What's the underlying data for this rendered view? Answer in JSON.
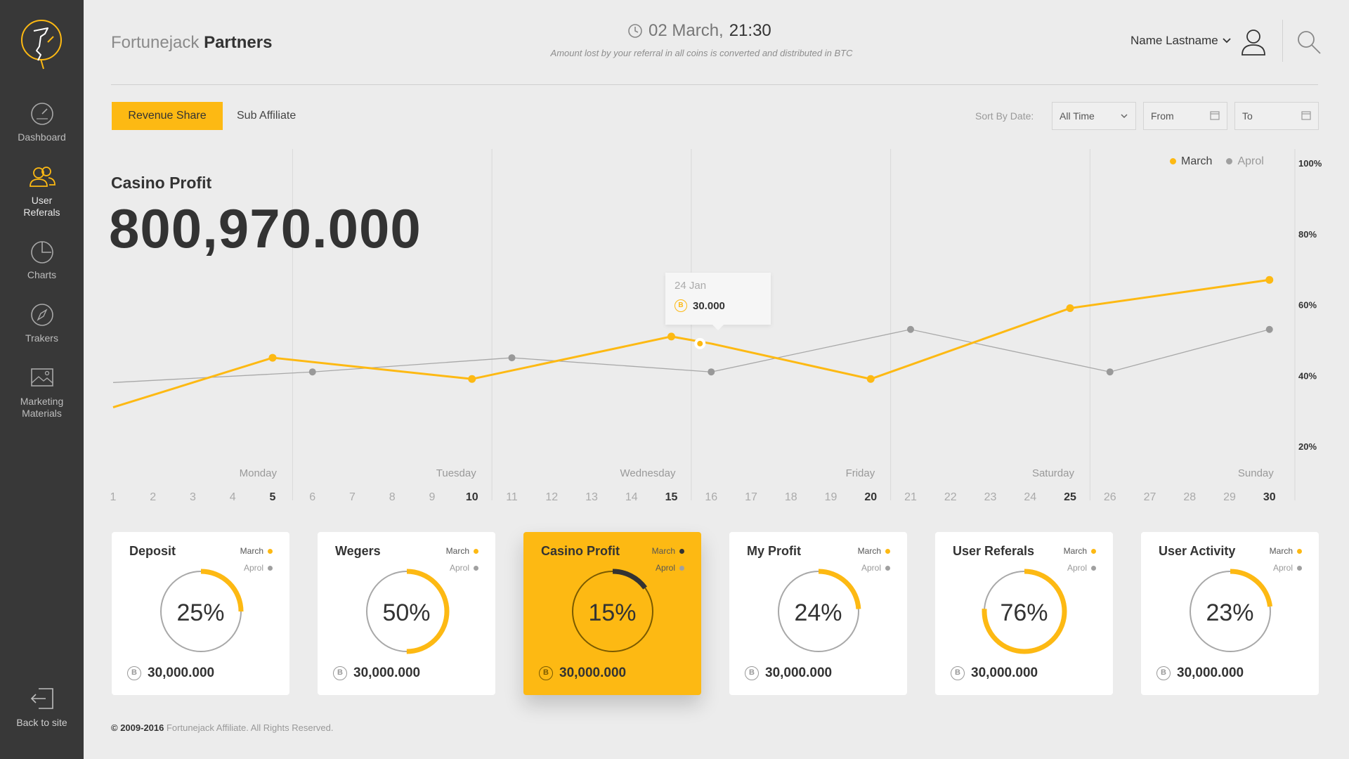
{
  "sidebar": {
    "items": [
      {
        "label": "Dashboard",
        "icon": "gauge-icon"
      },
      {
        "label": "User Referals",
        "icon": "users-icon"
      },
      {
        "label": "Charts",
        "icon": "pie-chart-icon"
      },
      {
        "label": "Trakers",
        "icon": "compass-icon"
      },
      {
        "label": "Marketing Materials",
        "icon": "image-icon"
      }
    ],
    "back_label": "Back to site"
  },
  "header": {
    "brand_light": "Fortunejack",
    "brand_bold": "Partners",
    "date": "02 March,",
    "time": "21:30",
    "note": "Amount lost by your referral in all coins is converted and distributed in BTC",
    "user_name": "Name Lastname"
  },
  "tabs": {
    "active": "Revenue Share",
    "other": "Sub Affiliate"
  },
  "filters": {
    "sort_label": "Sort By Date:",
    "period": "All Time",
    "from": "From",
    "to": "To"
  },
  "chart": {
    "title": "Casino Profit",
    "big_value": "800,970.000",
    "legend": [
      {
        "name": "March",
        "color": "#fdb913"
      },
      {
        "name": "Aprol",
        "color": "#a0a0a0"
      }
    ],
    "tooltip": {
      "date": "24 Jan",
      "value": "30.000"
    }
  },
  "chart_data": {
    "type": "line",
    "x": [
      1,
      2,
      3,
      4,
      5,
      6,
      7,
      8,
      9,
      10,
      11,
      12,
      13,
      14,
      15,
      16,
      17,
      18,
      19,
      20,
      21,
      22,
      23,
      24,
      25,
      26,
      27,
      28,
      29,
      30
    ],
    "day_labels": [
      "Monday",
      "Tuesday",
      "Wednesday",
      "Friday",
      "Saturday",
      "Sunday"
    ],
    "y_ticks": [
      "100%",
      "80%",
      "60%",
      "40%",
      "20%"
    ],
    "ylim": [
      0,
      100
    ],
    "series": [
      {
        "name": "March",
        "color": "#fdb913",
        "points": [
          [
            1,
            31
          ],
          [
            5,
            45
          ],
          [
            10,
            39
          ],
          [
            15,
            51
          ],
          [
            16,
            49
          ],
          [
            20,
            39
          ],
          [
            25,
            59
          ],
          [
            30,
            67
          ]
        ]
      },
      {
        "name": "Aprol",
        "color": "#a0a0a0",
        "points": [
          [
            1,
            38
          ],
          [
            6,
            41
          ],
          [
            11,
            45
          ],
          [
            16,
            41
          ],
          [
            21,
            53
          ],
          [
            26,
            41
          ],
          [
            30,
            53
          ]
        ]
      }
    ]
  },
  "cards": [
    {
      "title": "Deposit",
      "pct": "25%",
      "pct_value": 25,
      "amount": "30,000.000"
    },
    {
      "title": "Wegers",
      "pct": "50%",
      "pct_value": 50,
      "amount": "30,000.000"
    },
    {
      "title": "Casino Profit",
      "pct": "15%",
      "pct_value": 15,
      "amount": "30,000.000"
    },
    {
      "title": "My Profit",
      "pct": "24%",
      "pct_value": 24,
      "amount": "30,000.000"
    },
    {
      "title": "User Referals",
      "pct": "76%",
      "pct_value": 76,
      "amount": "30,000.000"
    },
    {
      "title": "User Activity",
      "pct": "23%",
      "pct_value": 23,
      "amount": "30,000.000"
    }
  ],
  "card_legend": {
    "a": "March",
    "b": "Aprol"
  },
  "footer": {
    "years": "© 2009-2016",
    "text": "Fortunejack Affiliate. All Rights Reserved."
  }
}
